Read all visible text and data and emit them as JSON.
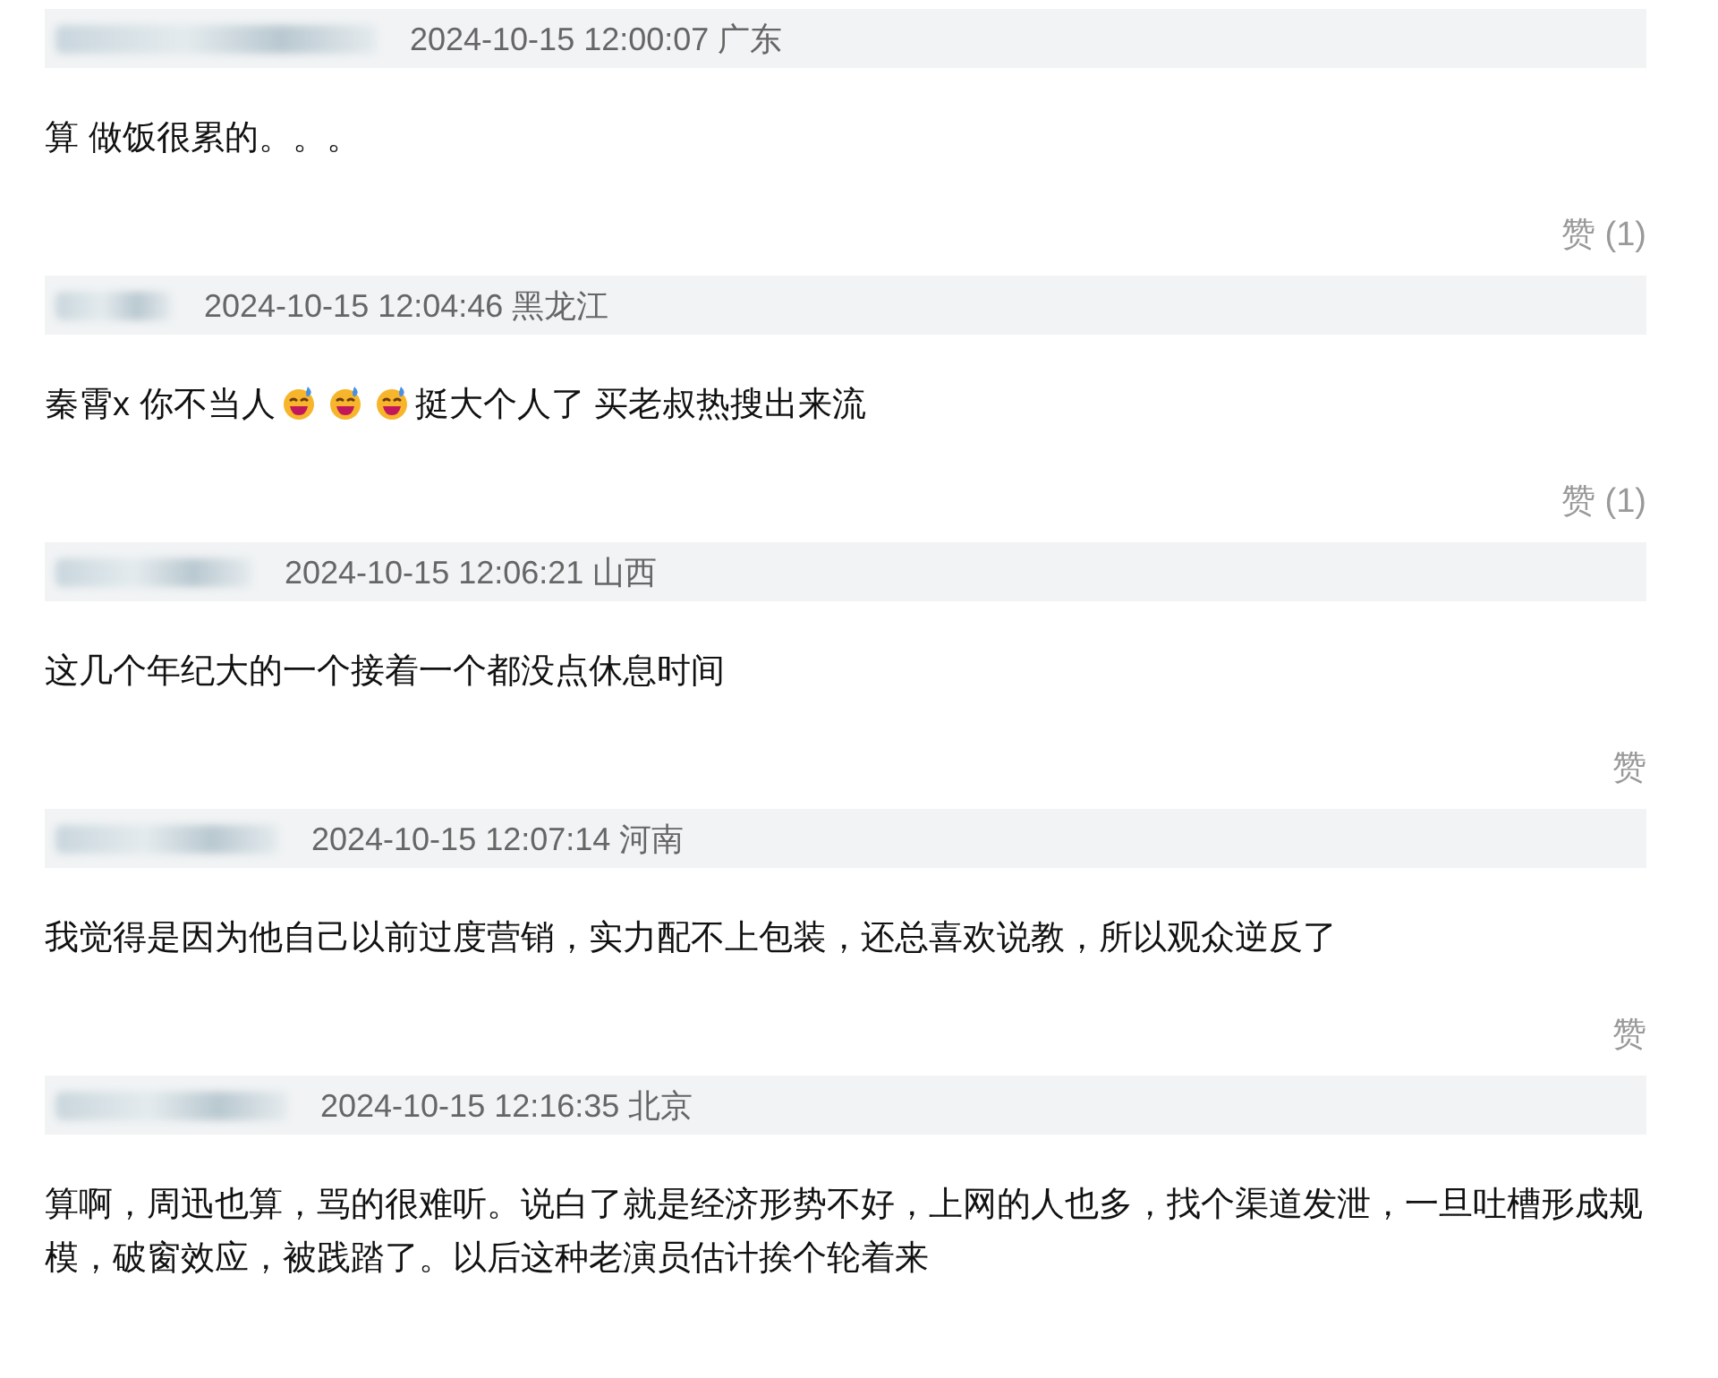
{
  "comments": [
    {
      "time": "2024-10-15 12:00:07",
      "location": "广东",
      "content": [
        {
          "kind": "text",
          "text": "算 做饭很累的。。。"
        }
      ],
      "like": "赞 (1)"
    },
    {
      "time": "2024-10-15 12:04:46",
      "location": "黑龙江",
      "content": [
        {
          "kind": "text",
          "text": "秦霄x 你不当人"
        },
        {
          "kind": "emoji"
        },
        {
          "kind": "emoji"
        },
        {
          "kind": "emoji"
        },
        {
          "kind": "text",
          "text": "挺大个人了 买老叔热搜出来流"
        }
      ],
      "like": "赞 (1)"
    },
    {
      "time": "2024-10-15 12:06:21",
      "location": "山西",
      "content": [
        {
          "kind": "text",
          "text": "这几个年纪大的一个接着一个都没点休息时间"
        }
      ],
      "like": "赞"
    },
    {
      "time": "2024-10-15 12:07:14",
      "location": "河南",
      "content": [
        {
          "kind": "text",
          "text": "我觉得是因为他自己以前过度营销，实力配不上包装，还总喜欢说教，所以观众逆反了"
        }
      ],
      "like": "赞"
    },
    {
      "time": "2024-10-15 12:16:35",
      "location": "北京",
      "content": [
        {
          "kind": "text",
          "text": "算啊，周迅也算，骂的很难听。说白了就是经济形势不好，上网的人也多，找个渠道发泄，一旦吐槽形成规模，破窗效应，被践踏了。以后这种老演员估计挨个轮着来"
        }
      ]
    }
  ]
}
